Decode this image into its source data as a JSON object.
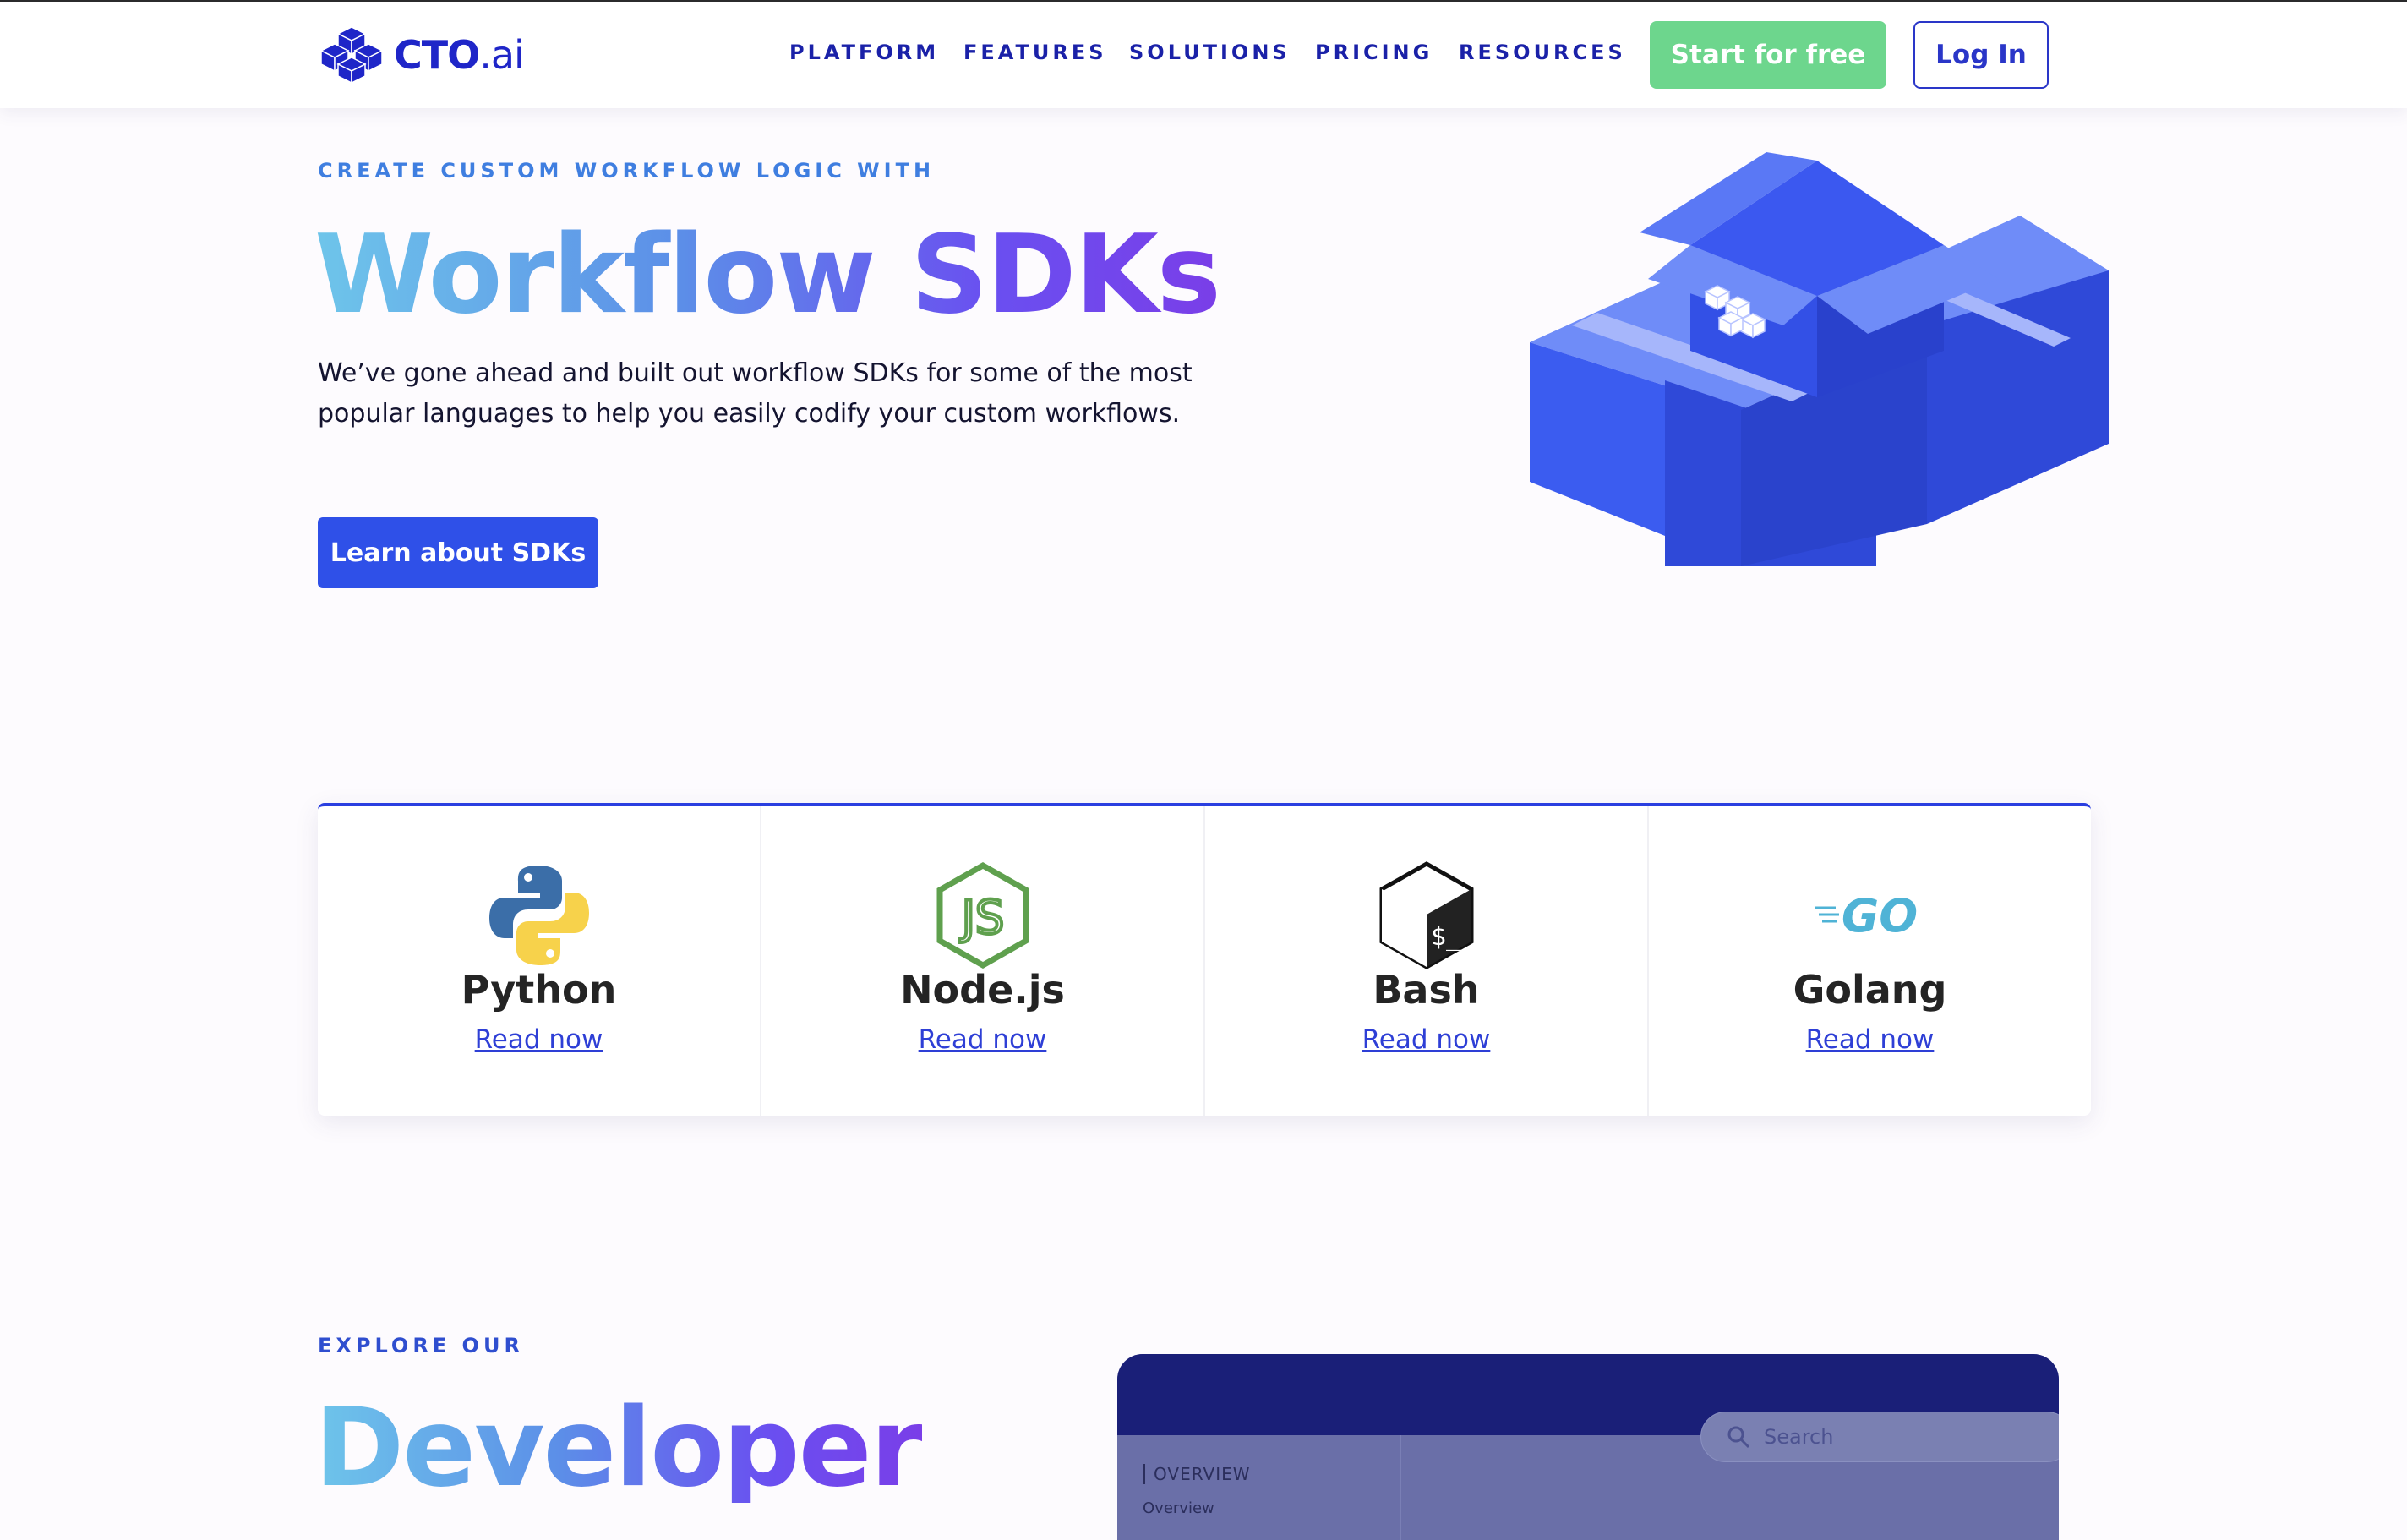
{
  "header": {
    "logo": {
      "brand": "CTO",
      "suffix": ".ai"
    },
    "nav": [
      "PLATFORM",
      "FEATURES",
      "SOLUTIONS",
      "PRICING",
      "RESOURCES"
    ],
    "start_label": "Start for free",
    "login_label": "Log In"
  },
  "hero": {
    "eyebrow": "CREATE CUSTOM WORKFLOW LOGIC WITH",
    "title": "Workflow SDKs",
    "description": "We’ve gone ahead and built out workflow SDKs for some of the most popular languages to help you easily codify your custom workflows.",
    "cta_label": "Learn about SDKs"
  },
  "sdks": [
    {
      "name": "Python",
      "link": "Read now",
      "icon": "python-icon"
    },
    {
      "name": "Node.js",
      "link": "Read now",
      "icon": "nodejs-icon"
    },
    {
      "name": "Bash",
      "link": "Read now",
      "icon": "bash-icon"
    },
    {
      "name": "Golang",
      "link": "Read now",
      "icon": "golang-icon"
    }
  ],
  "explore": {
    "eyebrow": "EXPLORE OUR",
    "title": "Developer",
    "docs_preview": {
      "search_placeholder": "Search",
      "sidebar_heading": "OVERVIEW",
      "sidebar_item": "Overview"
    }
  },
  "colors": {
    "brand_blue": "#1f26c8",
    "cta_green": "#6dd68d",
    "cta_blue": "#2f50e8",
    "link_blue": "#2e3fd6"
  }
}
